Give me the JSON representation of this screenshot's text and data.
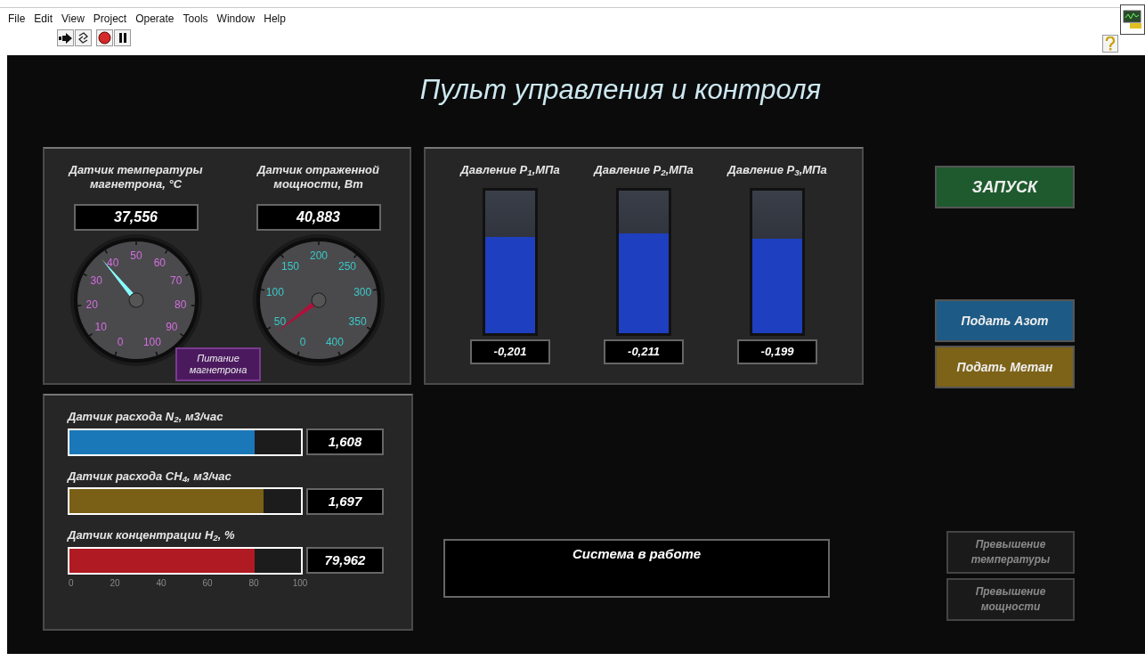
{
  "menu": [
    "File",
    "Edit",
    "View",
    "Project",
    "Operate",
    "Tools",
    "Window",
    "Help"
  ],
  "title": "Пульт управления и контроля",
  "gauges": [
    {
      "label": "Датчик температуры магнетрона, °C",
      "reading": "37,556",
      "scale": [
        "0",
        "10",
        "20",
        "30",
        "40",
        "50",
        "60",
        "70",
        "80",
        "90",
        "100"
      ]
    },
    {
      "label": "Датчик отраженной мощности, Вт",
      "reading": "40,883",
      "scale": [
        "0",
        "50",
        "100",
        "150",
        "200",
        "250",
        "300",
        "350",
        "400"
      ]
    }
  ],
  "power_button": "Питание магнетрона",
  "pressures": [
    {
      "label": "Давление P$_{1}$,МПа",
      "level": 0.67,
      "reading": "-0,201"
    },
    {
      "label": "Давление P$_{2}$,МПа",
      "level": 0.7,
      "reading": "-0,211"
    },
    {
      "label": "Давление P$_{3}$,МПа",
      "level": 0.66,
      "reading": "-0,199"
    }
  ],
  "flows": [
    {
      "label": "Датчик расхода N$_{2}$, м3/час",
      "level": 0.8,
      "reading": "1,608",
      "color": "#1a78b8"
    },
    {
      "label": "Датчик расхода CH$_{4}$, м3/час",
      "level": 0.84,
      "reading": "1,697",
      "color": "#7a5f16"
    },
    {
      "label": "Датчик концентрации H$_{2}$, %",
      "level": 0.8,
      "reading": "79,962",
      "color": "#b01a22"
    }
  ],
  "flow_scale": [
    "0",
    "20",
    "40",
    "60",
    "80",
    "100"
  ],
  "start_button": "ЗАПУСК",
  "feed_buttons": [
    {
      "label": "Подать Азот",
      "color": "#1d5a85"
    },
    {
      "label": "Подать Метан",
      "color": "#7d6318"
    }
  ],
  "status_message": "Система в работе",
  "alarms": [
    {
      "label": "Превышение температуры",
      "on": false
    },
    {
      "label": "Превышение мощности",
      "on": false
    }
  ]
}
